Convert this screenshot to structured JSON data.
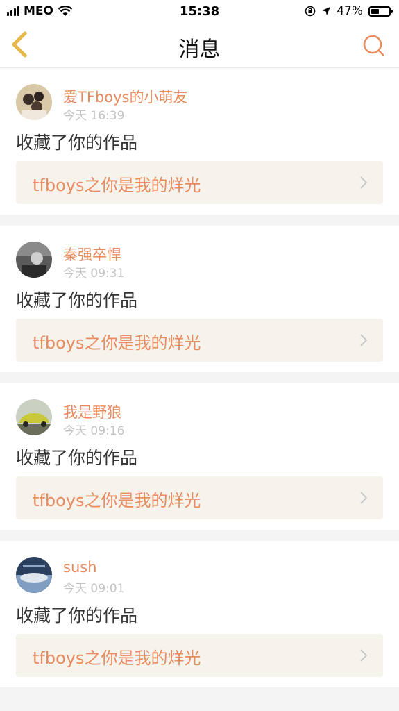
{
  "status_bar": {
    "carrier": "MEO",
    "time": "15:38",
    "battery_percent": "47%",
    "battery_level": 0.47
  },
  "nav": {
    "title": "消息",
    "back_icon": "chevron-left-icon",
    "search_icon": "search-icon"
  },
  "colors": {
    "accent": "#e88b5e",
    "back_arrow": "#e8b84a",
    "card_bg": "#f5f3ec"
  },
  "messages": [
    {
      "username": "爱TFboys的小萌友",
      "time": "今天 16:39",
      "action": "收藏了你的作品",
      "work_title": "tfboys之你是我的烊光"
    },
    {
      "username": "秦强卒悍",
      "time": "今天 09:31",
      "action": "收藏了你的作品",
      "work_title": "tfboys之你是我的烊光"
    },
    {
      "username": "我是野狼",
      "time": "今天 09:16",
      "action": "收藏了你的作品",
      "work_title": "tfboys之你是我的烊光"
    },
    {
      "username": "sush",
      "time": "今天 09:01",
      "action": "收藏了你的作品",
      "work_title": "tfboys之你是我的烊光"
    }
  ]
}
